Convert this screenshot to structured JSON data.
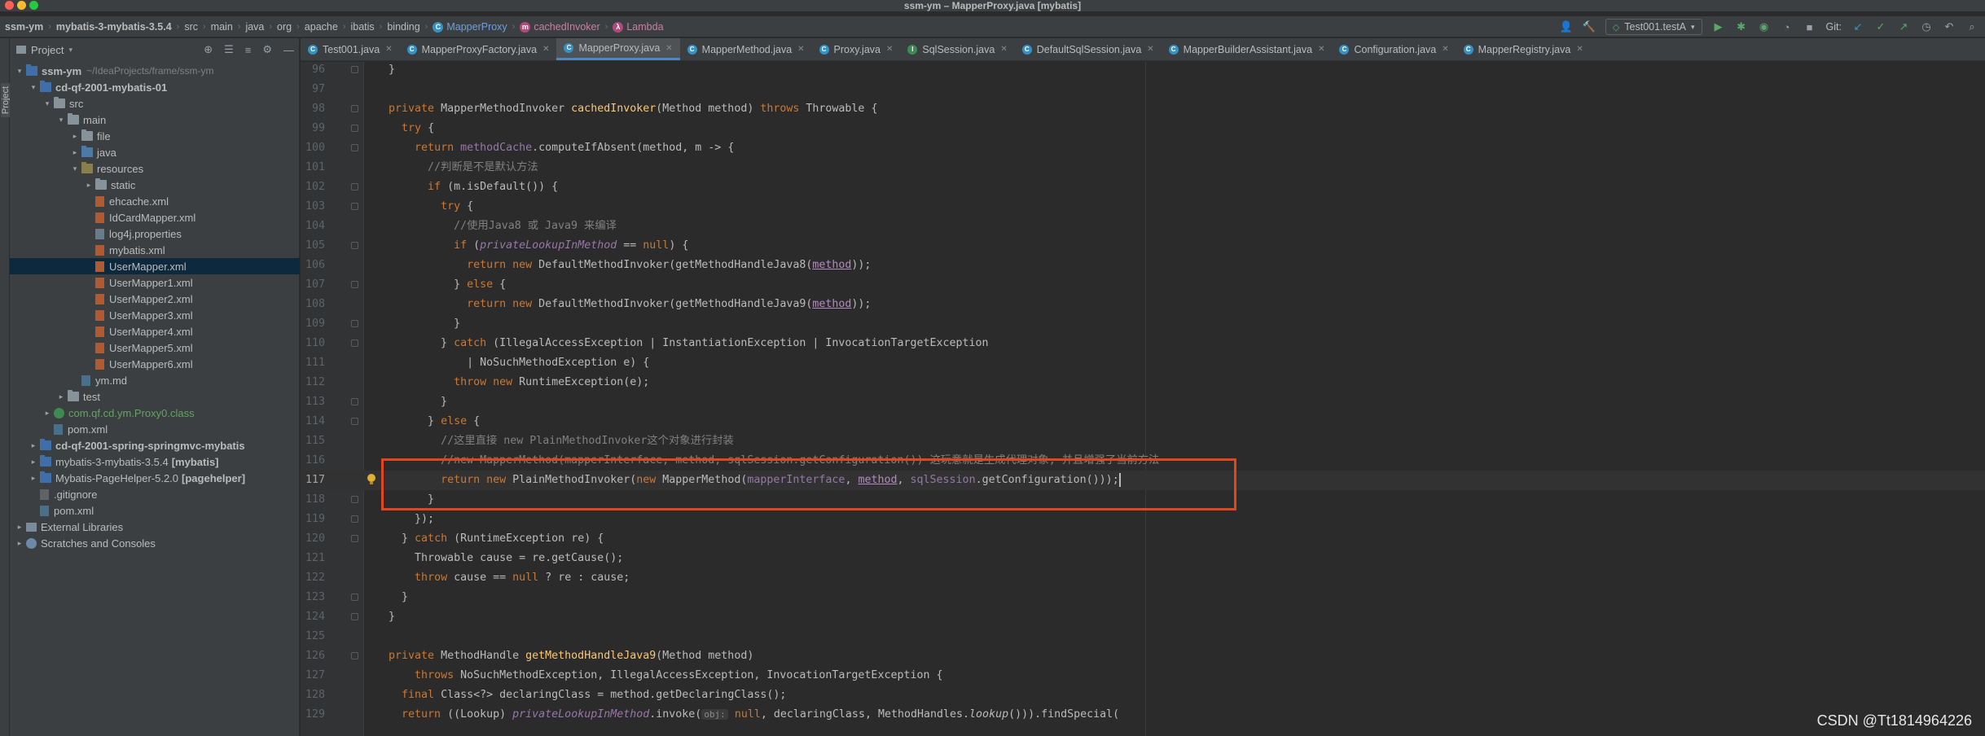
{
  "window": {
    "title": "ssm-ym – MapperProxy.java [mybatis]"
  },
  "breadcrumbs": [
    {
      "label": "ssm-ym",
      "bold": true,
      "icon": ""
    },
    {
      "label": "mybatis-3-mybatis-3.5.4",
      "bold": true,
      "icon": ""
    },
    {
      "label": "src",
      "bold": false,
      "icon": ""
    },
    {
      "label": "main",
      "bold": false,
      "icon": ""
    },
    {
      "label": "java",
      "bold": false,
      "icon": ""
    },
    {
      "label": "org",
      "bold": false,
      "icon": ""
    },
    {
      "label": "apache",
      "bold": false,
      "icon": ""
    },
    {
      "label": "ibatis",
      "bold": false,
      "icon": ""
    },
    {
      "label": "binding",
      "bold": false,
      "icon": ""
    },
    {
      "label": "MapperProxy",
      "bold": false,
      "icon": "class"
    },
    {
      "label": "cachedInvoker",
      "bold": false,
      "icon": "method"
    },
    {
      "label": "Lambda",
      "bold": false,
      "icon": "lambda"
    }
  ],
  "toolbar": {
    "run_config": "Test001.testA",
    "git_label": "Git:"
  },
  "project_panel": {
    "title": "Project",
    "side_tab": "Project",
    "tree": [
      {
        "indent": 0,
        "arrow": "▾",
        "icon": "mod",
        "label": "ssm-ym",
        "bold": true,
        "extra": "~/IdeaProjects/frame/ssm-ym"
      },
      {
        "indent": 1,
        "arrow": "▾",
        "icon": "mod",
        "label": "cd-qf-2001-mybatis-01",
        "bold": true
      },
      {
        "indent": 2,
        "arrow": "▾",
        "icon": "folder",
        "label": "src"
      },
      {
        "indent": 3,
        "arrow": "▾",
        "icon": "folder",
        "label": "main"
      },
      {
        "indent": 4,
        "arrow": "▸",
        "icon": "folder",
        "label": "file"
      },
      {
        "indent": 4,
        "arrow": "▸",
        "icon": "src",
        "label": "java"
      },
      {
        "indent": 4,
        "arrow": "▾",
        "icon": "res",
        "label": "resources"
      },
      {
        "indent": 5,
        "arrow": "▸",
        "icon": "folder",
        "label": "static"
      },
      {
        "indent": 5,
        "arrow": "",
        "icon": "xml",
        "label": "ehcache.xml"
      },
      {
        "indent": 5,
        "arrow": "",
        "icon": "xml",
        "label": "IdCardMapper.xml"
      },
      {
        "indent": 5,
        "arrow": "",
        "icon": "prop",
        "label": "log4j.properties"
      },
      {
        "indent": 5,
        "arrow": "",
        "icon": "xml",
        "label": "mybatis.xml"
      },
      {
        "indent": 5,
        "arrow": "",
        "icon": "xml",
        "label": "UserMapper.xml",
        "selected": true
      },
      {
        "indent": 5,
        "arrow": "",
        "icon": "xml",
        "label": "UserMapper1.xml"
      },
      {
        "indent": 5,
        "arrow": "",
        "icon": "xml",
        "label": "UserMapper2.xml"
      },
      {
        "indent": 5,
        "arrow": "",
        "icon": "xml",
        "label": "UserMapper3.xml"
      },
      {
        "indent": 5,
        "arrow": "",
        "icon": "xml",
        "label": "UserMapper4.xml"
      },
      {
        "indent": 5,
        "arrow": "",
        "icon": "xml",
        "label": "UserMapper5.xml"
      },
      {
        "indent": 5,
        "arrow": "",
        "icon": "xml",
        "label": "UserMapper6.xml"
      },
      {
        "indent": 4,
        "arrow": "",
        "icon": "md",
        "label": "ym.md"
      },
      {
        "indent": 3,
        "arrow": "▸",
        "icon": "folder",
        "label": "test"
      },
      {
        "indent": 2,
        "arrow": "▸",
        "icon": "cls",
        "label": "com.qf.cd.ym.Proxy0.class",
        "green": true
      },
      {
        "indent": 2,
        "arrow": "",
        "icon": "md",
        "label": "pom.xml"
      },
      {
        "indent": 1,
        "arrow": "▸",
        "icon": "mod",
        "label": "cd-qf-2001-spring-springmvc-mybatis",
        "bold": true
      },
      {
        "indent": 1,
        "arrow": "▸",
        "icon": "mod",
        "label": "mybatis-3-mybatis-3.5.4",
        "extra2": "[mybatis]"
      },
      {
        "indent": 1,
        "arrow": "▸",
        "icon": "mod",
        "label": "Mybatis-PageHelper-5.2.0",
        "extra2": "[pagehelper]"
      },
      {
        "indent": 1,
        "arrow": "",
        "icon": "git",
        "label": ".gitignore"
      },
      {
        "indent": 1,
        "arrow": "",
        "icon": "md",
        "label": "pom.xml"
      },
      {
        "indent": 0,
        "arrow": "▸",
        "icon": "lib",
        "label": "External Libraries"
      },
      {
        "indent": 0,
        "arrow": "▸",
        "icon": "scr",
        "label": "Scratches and Consoles"
      }
    ]
  },
  "tabs": [
    {
      "label": "Test001.java",
      "icon": "c",
      "active": false
    },
    {
      "label": "MapperProxyFactory.java",
      "icon": "c",
      "active": false
    },
    {
      "label": "MapperProxy.java",
      "icon": "c",
      "active": true
    },
    {
      "label": "MapperMethod.java",
      "icon": "c",
      "active": false
    },
    {
      "label": "Proxy.java",
      "icon": "c",
      "active": false
    },
    {
      "label": "SqlSession.java",
      "icon": "i",
      "active": false
    },
    {
      "label": "DefaultSqlSession.java",
      "icon": "c",
      "active": false
    },
    {
      "label": "MapperBuilderAssistant.java",
      "icon": "c",
      "active": false
    },
    {
      "label": "Configuration.java",
      "icon": "c",
      "active": false
    },
    {
      "label": "MapperRegistry.java",
      "icon": "c",
      "active": false
    }
  ],
  "editor": {
    "current_line": "117",
    "lines": [
      {
        "num": "96",
        "fold": true,
        "segs": [
          [
            "",
            "  }"
          ]
        ]
      },
      {
        "num": "97",
        "fold": false,
        "segs": []
      },
      {
        "num": "98",
        "fold": true,
        "segs": [
          [
            "",
            "  "
          ],
          [
            "kw",
            "private "
          ],
          [
            "",
            "MapperMethodInvoker "
          ],
          [
            "fn",
            "cachedInvoker"
          ],
          [
            "",
            "(Method method) "
          ],
          [
            "kw",
            "throws "
          ],
          [
            "",
            "Throwable {"
          ]
        ]
      },
      {
        "num": "99",
        "fold": true,
        "segs": [
          [
            "",
            "    "
          ],
          [
            "kw",
            "try "
          ],
          [
            "",
            "{"
          ]
        ]
      },
      {
        "num": "100",
        "fold": true,
        "segs": [
          [
            "",
            "      "
          ],
          [
            "kw",
            "return "
          ],
          [
            "fld",
            "methodCache"
          ],
          [
            "",
            ".computeIfAbsent(method, m -> {"
          ]
        ]
      },
      {
        "num": "101",
        "fold": false,
        "segs": [
          [
            "",
            "        "
          ],
          [
            "cm",
            "//判断是不是默认方法"
          ]
        ]
      },
      {
        "num": "102",
        "fold": true,
        "segs": [
          [
            "",
            "        "
          ],
          [
            "kw",
            "if "
          ],
          [
            "",
            "(m.isDefault()) {"
          ]
        ]
      },
      {
        "num": "103",
        "fold": true,
        "segs": [
          [
            "",
            "          "
          ],
          [
            "kw",
            "try "
          ],
          [
            "",
            "{"
          ]
        ]
      },
      {
        "num": "104",
        "fold": false,
        "segs": [
          [
            "",
            "            "
          ],
          [
            "cm",
            "//使用Java8 或 Java9 来编译"
          ]
        ]
      },
      {
        "num": "105",
        "fold": true,
        "segs": [
          [
            "",
            "            "
          ],
          [
            "kw",
            "if "
          ],
          [
            "",
            "("
          ],
          [
            "fldi",
            "privateLookupInMethod"
          ],
          [
            "",
            " == "
          ],
          [
            "kw",
            "null"
          ],
          [
            "",
            ") {"
          ]
        ]
      },
      {
        "num": "106",
        "fold": false,
        "segs": [
          [
            "",
            "              "
          ],
          [
            "kw",
            "return new "
          ],
          [
            "",
            "DefaultMethodInvoker(getMethodHandleJava8("
          ],
          [
            "prm",
            "method"
          ],
          [
            "",
            "));"
          ]
        ]
      },
      {
        "num": "107",
        "fold": true,
        "segs": [
          [
            "",
            "            } "
          ],
          [
            "kw",
            "else "
          ],
          [
            "",
            "{"
          ]
        ]
      },
      {
        "num": "108",
        "fold": false,
        "segs": [
          [
            "",
            "              "
          ],
          [
            "kw",
            "return new "
          ],
          [
            "",
            "DefaultMethodInvoker(getMethodHandleJava9("
          ],
          [
            "prm",
            "method"
          ],
          [
            "",
            "));"
          ]
        ]
      },
      {
        "num": "109",
        "fold": true,
        "segs": [
          [
            "",
            "            }"
          ]
        ]
      },
      {
        "num": "110",
        "fold": true,
        "segs": [
          [
            "",
            "          } "
          ],
          [
            "kw",
            "catch "
          ],
          [
            "",
            "(IllegalAccessException | InstantiationException | InvocationTargetException"
          ]
        ]
      },
      {
        "num": "111",
        "fold": false,
        "segs": [
          [
            "",
            "              | NoSuchMethodException e) {"
          ]
        ]
      },
      {
        "num": "112",
        "fold": false,
        "segs": [
          [
            "",
            "            "
          ],
          [
            "kw",
            "throw new "
          ],
          [
            "",
            "RuntimeException(e);"
          ]
        ]
      },
      {
        "num": "113",
        "fold": true,
        "segs": [
          [
            "",
            "          }"
          ]
        ]
      },
      {
        "num": "114",
        "fold": true,
        "segs": [
          [
            "",
            "        } "
          ],
          [
            "kw",
            "else "
          ],
          [
            "",
            "{"
          ]
        ]
      },
      {
        "num": "115",
        "fold": false,
        "segs": [
          [
            "",
            "          "
          ],
          [
            "cm",
            "//这里直接 new PlainMethodInvoker这个对象进行封装"
          ]
        ]
      },
      {
        "num": "116",
        "fold": false,
        "segs": [
          [
            "",
            "          "
          ],
          [
            "cm",
            "//new MapperMethod(mapperInterface, method, sqlSession.getConfiguration()) 这玩意就是生成代理对象, 并且增强了当前方法"
          ]
        ]
      },
      {
        "num": "117",
        "fold": false,
        "bulb": true,
        "caret": true,
        "segs": [
          [
            "",
            "          "
          ],
          [
            "kw",
            "return new "
          ],
          [
            "",
            "PlainMethodInvoker("
          ],
          [
            "kw",
            "new "
          ],
          [
            "",
            "MapperMethod("
          ],
          [
            "fld",
            "mapperInterface"
          ],
          [
            "",
            ", "
          ],
          [
            "prm",
            "method"
          ],
          [
            "",
            ", "
          ],
          [
            "fld",
            "sqlSession"
          ],
          [
            "",
            ".getConfiguration()));"
          ]
        ]
      },
      {
        "num": "118",
        "fold": true,
        "segs": [
          [
            "",
            "        }"
          ]
        ]
      },
      {
        "num": "119",
        "fold": true,
        "segs": [
          [
            "",
            "      });"
          ]
        ]
      },
      {
        "num": "120",
        "fold": true,
        "segs": [
          [
            "",
            "    } "
          ],
          [
            "kw",
            "catch "
          ],
          [
            "",
            "(RuntimeException re) {"
          ]
        ]
      },
      {
        "num": "121",
        "fold": false,
        "segs": [
          [
            "",
            "      Throwable cause = re.getCause();"
          ]
        ]
      },
      {
        "num": "122",
        "fold": false,
        "segs": [
          [
            "",
            "      "
          ],
          [
            "kw",
            "throw "
          ],
          [
            "",
            "cause == "
          ],
          [
            "kw",
            "null "
          ],
          [
            "",
            "? re : cause;"
          ]
        ]
      },
      {
        "num": "123",
        "fold": true,
        "segs": [
          [
            "",
            "    }"
          ]
        ]
      },
      {
        "num": "124",
        "fold": true,
        "segs": [
          [
            "",
            "  }"
          ]
        ]
      },
      {
        "num": "125",
        "fold": false,
        "segs": []
      },
      {
        "num": "126",
        "fold": true,
        "segs": [
          [
            "",
            "  "
          ],
          [
            "kw",
            "private "
          ],
          [
            "",
            "MethodHandle "
          ],
          [
            "fn",
            "getMethodHandleJava9"
          ],
          [
            "",
            "(Method method)"
          ]
        ]
      },
      {
        "num": "127",
        "fold": false,
        "segs": [
          [
            "",
            "      "
          ],
          [
            "kw",
            "throws "
          ],
          [
            "",
            "NoSuchMethodException, IllegalAccessException, InvocationTargetException {"
          ]
        ]
      },
      {
        "num": "128",
        "fold": false,
        "segs": [
          [
            "",
            "    "
          ],
          [
            "kw",
            "final "
          ],
          [
            "",
            "Class<?> declaringClass = method.getDeclaringClass();"
          ]
        ]
      },
      {
        "num": "129",
        "fold": false,
        "segs": [
          [
            "",
            "    "
          ],
          [
            "kw",
            "return "
          ],
          [
            "",
            "((Lookup) "
          ],
          [
            "fldi",
            "privateLookupInMethod"
          ],
          [
            "",
            ".invoke("
          ],
          [
            "hint",
            "obj:"
          ],
          [
            "",
            " "
          ],
          [
            "kw",
            "null"
          ],
          [
            "",
            ", declaringClass, MethodHandles."
          ],
          [
            "sti",
            "lookup"
          ],
          [
            "",
            "())).findSpecial("
          ]
        ]
      }
    ]
  },
  "watermark": "CSDN @Tt1814964226"
}
